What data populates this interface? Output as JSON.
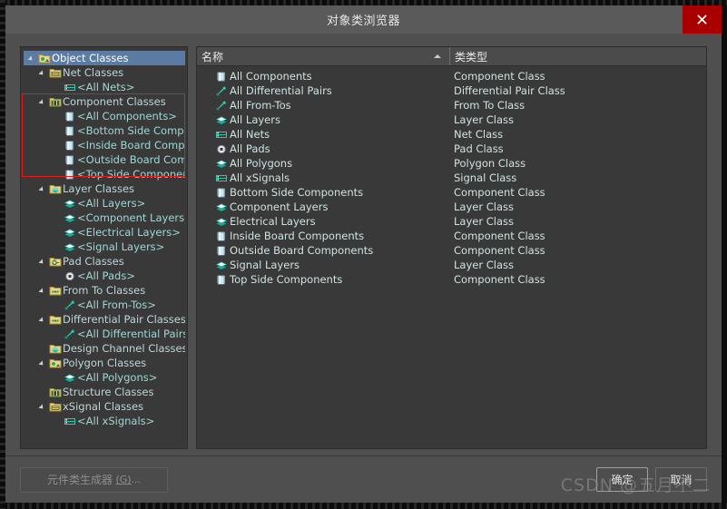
{
  "window": {
    "title": "对象类浏览器",
    "close_label": "✕"
  },
  "tree": {
    "items": [
      {
        "label": "Object Classes",
        "depth": 1,
        "icon": "object-classes-folder-icon",
        "expanded": true,
        "selected": true,
        "child": false
      },
      {
        "label": "Net Classes",
        "depth": 2,
        "icon": "net-classes-folder-icon",
        "expanded": true,
        "selected": false,
        "child": false
      },
      {
        "label": "<All Nets>",
        "depth": 3,
        "icon": "net-icon",
        "expanded": false,
        "selected": false,
        "child": true
      },
      {
        "label": "Component Classes",
        "depth": 2,
        "icon": "component-classes-folder-icon",
        "expanded": true,
        "selected": false,
        "child": false
      },
      {
        "label": "<All Components>",
        "depth": 3,
        "icon": "component-icon",
        "expanded": false,
        "selected": false,
        "child": true
      },
      {
        "label": "<Bottom Side Compor",
        "depth": 3,
        "icon": "component-icon",
        "expanded": false,
        "selected": false,
        "child": true
      },
      {
        "label": "<Inside Board Compo",
        "depth": 3,
        "icon": "component-icon",
        "expanded": false,
        "selected": false,
        "child": true
      },
      {
        "label": "<Outside Board Comp",
        "depth": 3,
        "icon": "component-icon",
        "expanded": false,
        "selected": false,
        "child": true
      },
      {
        "label": "<Top Side Componen",
        "depth": 3,
        "icon": "component-icon",
        "expanded": false,
        "selected": false,
        "child": true
      },
      {
        "label": "Layer Classes",
        "depth": 2,
        "icon": "layer-classes-folder-icon",
        "expanded": true,
        "selected": false,
        "child": false
      },
      {
        "label": "<All Layers>",
        "depth": 3,
        "icon": "layer-icon",
        "expanded": false,
        "selected": false,
        "child": true
      },
      {
        "label": "<Component Layers>",
        "depth": 3,
        "icon": "layer-icon",
        "expanded": false,
        "selected": false,
        "child": true
      },
      {
        "label": "<Electrical Layers>",
        "depth": 3,
        "icon": "layer-icon",
        "expanded": false,
        "selected": false,
        "child": true
      },
      {
        "label": "<Signal Layers>",
        "depth": 3,
        "icon": "layer-icon",
        "expanded": false,
        "selected": false,
        "child": true
      },
      {
        "label": "Pad Classes",
        "depth": 2,
        "icon": "pad-classes-folder-icon",
        "expanded": true,
        "selected": false,
        "child": false
      },
      {
        "label": "<All Pads>",
        "depth": 3,
        "icon": "pad-icon",
        "expanded": false,
        "selected": false,
        "child": true
      },
      {
        "label": "From To Classes",
        "depth": 2,
        "icon": "fromto-classes-folder-icon",
        "expanded": true,
        "selected": false,
        "child": false
      },
      {
        "label": "<All From-Tos>",
        "depth": 3,
        "icon": "fromto-icon",
        "expanded": false,
        "selected": false,
        "child": true
      },
      {
        "label": "Differential Pair Classes",
        "depth": 2,
        "icon": "diffpair-classes-folder-icon",
        "expanded": true,
        "selected": false,
        "child": false
      },
      {
        "label": "<All Differential Pairs>",
        "depth": 3,
        "icon": "diffpair-icon",
        "expanded": false,
        "selected": false,
        "child": true
      },
      {
        "label": "Design Channel Classes",
        "depth": 2,
        "icon": "design-channel-folder-icon",
        "expanded": false,
        "selected": false,
        "child": false
      },
      {
        "label": "Polygon Classes",
        "depth": 2,
        "icon": "polygon-classes-folder-icon",
        "expanded": true,
        "selected": false,
        "child": false
      },
      {
        "label": "<All Polygons>",
        "depth": 3,
        "icon": "polygon-icon",
        "expanded": false,
        "selected": false,
        "child": true
      },
      {
        "label": "Structure Classes",
        "depth": 2,
        "icon": "structure-classes-folder-icon",
        "expanded": false,
        "selected": false,
        "child": false
      },
      {
        "label": "xSignal Classes",
        "depth": 2,
        "icon": "xsignal-classes-folder-icon",
        "expanded": true,
        "selected": false,
        "child": false
      },
      {
        "label": "<All xSignals>",
        "depth": 3,
        "icon": "xsignal-icon",
        "expanded": false,
        "selected": false,
        "child": true
      }
    ]
  },
  "list": {
    "columns": {
      "name": "名称",
      "type": "类类型"
    },
    "rows": [
      {
        "name": "All Components",
        "type": "Component Class",
        "icon": "component-icon"
      },
      {
        "name": "All Differential Pairs",
        "type": "Differential Pair Class",
        "icon": "diffpair-icon"
      },
      {
        "name": "All From-Tos",
        "type": "From To Class",
        "icon": "fromto-icon"
      },
      {
        "name": "All Layers",
        "type": "Layer Class",
        "icon": "layer-icon"
      },
      {
        "name": "All Nets",
        "type": "Net Class",
        "icon": "net-icon"
      },
      {
        "name": "All Pads",
        "type": "Pad Class",
        "icon": "pad-icon"
      },
      {
        "name": "All Polygons",
        "type": "Polygon Class",
        "icon": "polygon-icon"
      },
      {
        "name": "All xSignals",
        "type": "Signal Class",
        "icon": "xsignal-icon"
      },
      {
        "name": "Bottom Side Components",
        "type": "Component Class",
        "icon": "component-icon"
      },
      {
        "name": "Component Layers",
        "type": "Layer Class",
        "icon": "layer-icon"
      },
      {
        "name": "Electrical Layers",
        "type": "Layer Class",
        "icon": "layer-icon"
      },
      {
        "name": "Inside Board Components",
        "type": "Component Class",
        "icon": "component-icon"
      },
      {
        "name": "Outside Board Components",
        "type": "Component Class",
        "icon": "component-icon"
      },
      {
        "name": "Signal Layers",
        "type": "Layer Class",
        "icon": "layer-icon"
      },
      {
        "name": "Top Side Components",
        "type": "Component Class",
        "icon": "component-icon"
      }
    ]
  },
  "footer": {
    "generator_label": "元件类生成器",
    "generator_mnemonic": "(G)",
    "generator_suffix": "...",
    "ok_label": "确定",
    "cancel_label": "取消",
    "watermark": "CSDN @五月不二"
  },
  "colors": {
    "selection": "#5b7ba3",
    "highlight_box": "#e01b1b",
    "close_button": "#a80000",
    "panel_bg": "#393939",
    "dialog_bg": "#4f4f4f",
    "text": "#cfe3e3"
  }
}
